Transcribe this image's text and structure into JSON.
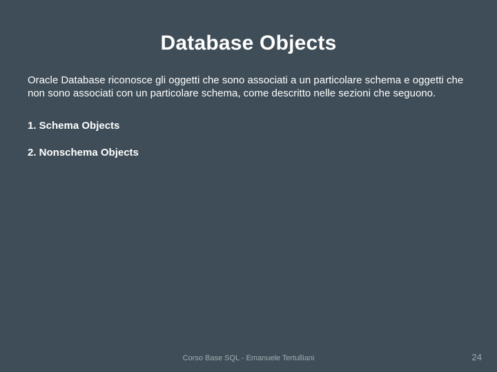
{
  "title": "Database Objects",
  "paragraph": "Oracle Database riconosce gli oggetti che sono associati a un particolare schema e oggetti che non sono associati con un particolare schema, come descritto nelle sezioni che seguono.",
  "items": [
    "1.  Schema Objects",
    "2.  Nonschema Objects"
  ],
  "footer": "Corso Base SQL - Emanuele Tertulliani",
  "page_number": "24"
}
